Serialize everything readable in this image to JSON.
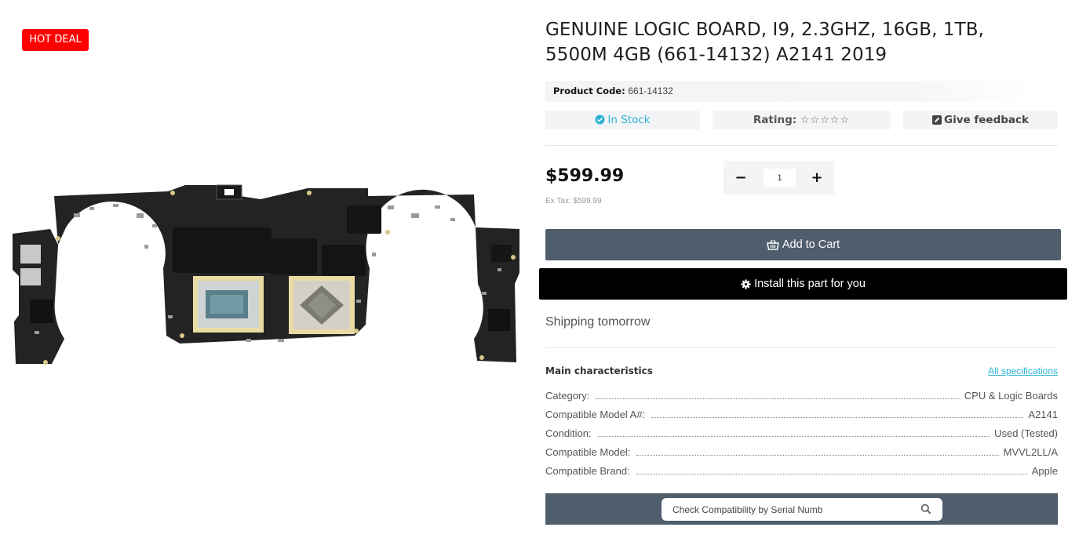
{
  "badge": {
    "label": "HOT DEAL",
    "color": "#ff0000"
  },
  "product": {
    "title": "GENUINE LOGIC BOARD, I9, 2.3GHZ, 16GB, 1TB, 5500M 4GB (661-14132) A2141 2019",
    "image_icon": "logic-board-image",
    "code_label": "Product Code:",
    "code_value": "661-14132",
    "stock": "In Stock",
    "rating_label": "Rating:",
    "rating_stars": "☆☆☆☆☆",
    "rating_value": 0,
    "feedback_label": "Give feedback",
    "price": "$599.99",
    "ex_tax": "Ex Tax: $599.99",
    "quantity": "1",
    "qty_minus": "−",
    "qty_plus": "+"
  },
  "actions": {
    "add_to_cart": "Add to Cart",
    "install": "Install this part for you"
  },
  "shipping": "Shipping tomorrow",
  "characteristics": {
    "heading": "Main characteristics",
    "all_specs": "All specifications",
    "rows": [
      {
        "label": "Category:",
        "value": "CPU & Logic Boards"
      },
      {
        "label": "Compatible Model A#:",
        "value": "A2141"
      },
      {
        "label": "Condition:",
        "value": "Used (Tested)"
      },
      {
        "label": "Compatible Model:",
        "value": "MVVL2LL/A"
      },
      {
        "label": "Compatible Brand:",
        "value": "Apple"
      }
    ]
  },
  "compat_check": {
    "placeholder": "Check Compatibility by Serial Numb",
    "value": ""
  },
  "colors": {
    "accent": "#2bb3d6",
    "button_dark": "#4f5d6d",
    "hot": "#ff0000"
  }
}
